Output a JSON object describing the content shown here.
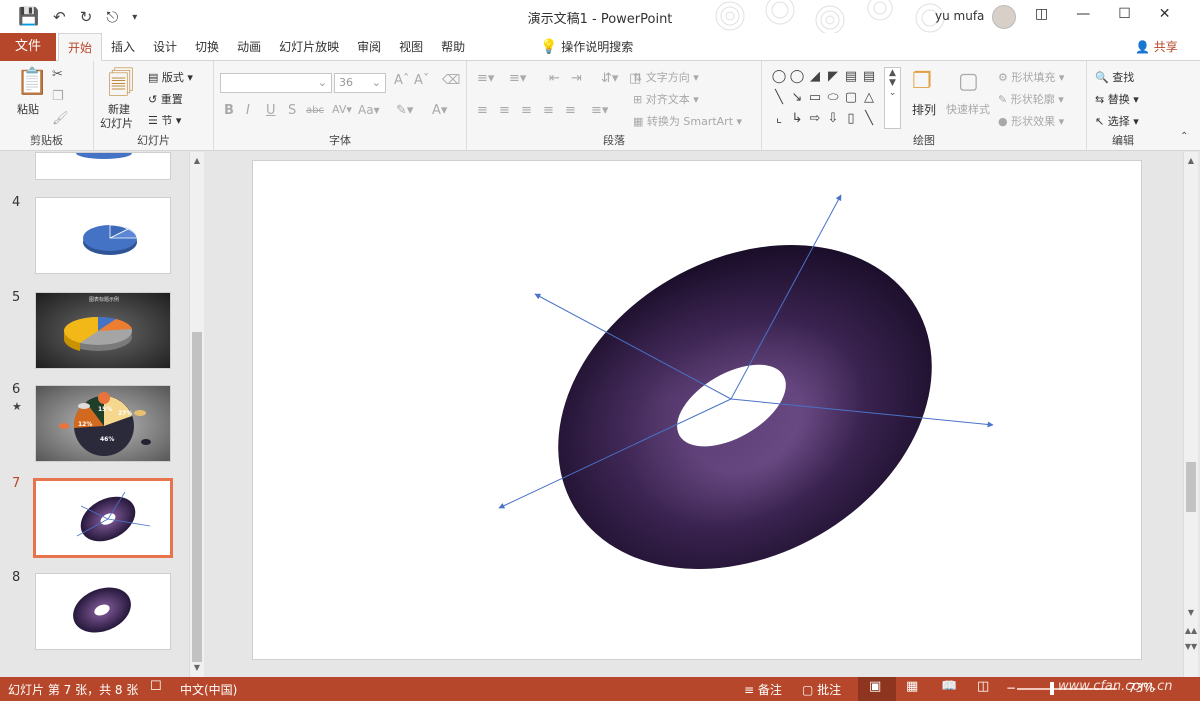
{
  "titlebar": {
    "doc_title": "演示文稿1  -  PowerPoint",
    "user": "yu mufa"
  },
  "tabs": {
    "file": "文件",
    "items": [
      "开始",
      "插入",
      "设计",
      "切换",
      "动画",
      "幻灯片放映",
      "审阅",
      "视图",
      "帮助"
    ],
    "search": "操作说明搜索",
    "share": "共享"
  },
  "ribbon": {
    "clipboard": {
      "label": "剪贴板",
      "paste": "粘贴"
    },
    "slides": {
      "label": "幻灯片",
      "new_line1": "新建",
      "new_line2": "幻灯片",
      "layout": "版式",
      "reset": "重置",
      "section": "节"
    },
    "font": {
      "label": "字体",
      "size": "36"
    },
    "paragraph": {
      "label": "段落",
      "text_direction": "文字方向",
      "align_text": "对齐文本",
      "convert_smartart": "转换为 SmartArt"
    },
    "drawing": {
      "label": "绘图",
      "arrange": "排列",
      "quick_styles": "快速样式",
      "fill": "形状填充",
      "outline": "形状轮廓",
      "effects": "形状效果"
    },
    "editing": {
      "label": "编辑",
      "find": "查找",
      "replace": "替换",
      "select": "选择"
    }
  },
  "slides": {
    "numbers": [
      "4",
      "5",
      "6",
      "7",
      "8"
    ],
    "current": 7,
    "thumb5_title": "图表标题示例"
  },
  "thumb6_labels": [
    "15%",
    "27%",
    "12%",
    "46%"
  ],
  "status": {
    "slide_info": "幻灯片 第 7 张，共 8 张",
    "language": "中文(中国)",
    "notes": "备注",
    "comments": "批注",
    "zoom": "73%",
    "watermark": "www.cfan.com.cn"
  },
  "colors": {
    "accent": "#b7472a",
    "torus": "#3a2350",
    "selection": "#e8744d",
    "axis": "#4a72c8"
  }
}
